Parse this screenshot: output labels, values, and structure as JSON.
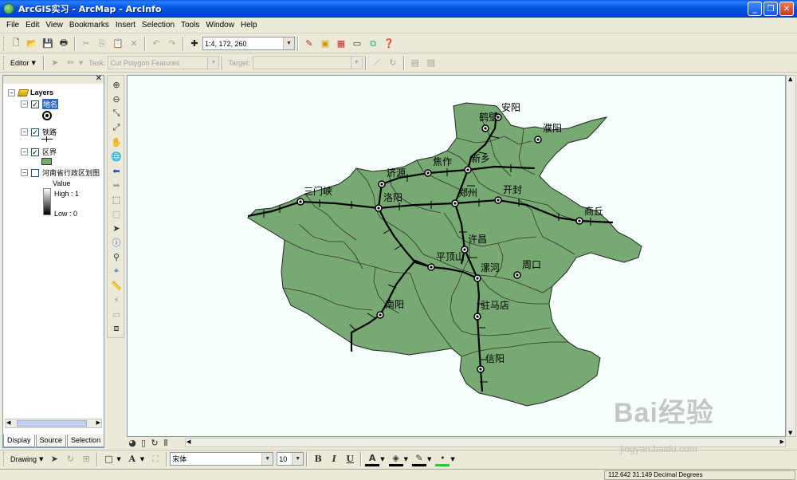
{
  "window": {
    "title": "ArcGIS实习 - ArcMap - ArcInfo"
  },
  "menu": [
    "File",
    "Edit",
    "View",
    "Bookmarks",
    "Insert",
    "Selection",
    "Tools",
    "Window",
    "Help"
  ],
  "standard_toolbar": {
    "scale": "1:4, 172, 260"
  },
  "editor_toolbar": {
    "editor_label": "Editor",
    "task_label": "Task:",
    "task_value": "Cut Polygon Features",
    "target_label": "Target:",
    "target_value": ""
  },
  "toc": {
    "root": "Layers",
    "layers": [
      {
        "name": "地名",
        "checked": true,
        "selected": true
      },
      {
        "name": "铁路",
        "checked": true
      },
      {
        "name": "区界",
        "checked": true
      },
      {
        "name": "河南省行政区划图",
        "checked": false
      }
    ],
    "raster_legend": {
      "value_label": "Value",
      "high_label": "High : 1",
      "low_label": "Low : 0"
    },
    "tabs": [
      "Display",
      "Source",
      "Selection"
    ]
  },
  "map": {
    "fill_color": "#76aa72",
    "background": "#f6fffe",
    "cities": [
      {
        "name": "安阳"
      },
      {
        "name": "鹤壁"
      },
      {
        "name": "濮阳"
      },
      {
        "name": "新乡"
      },
      {
        "name": "焦作"
      },
      {
        "name": "济源"
      },
      {
        "name": "三门峡"
      },
      {
        "name": "洛阳"
      },
      {
        "name": "郑州"
      },
      {
        "name": "开封"
      },
      {
        "name": "商丘"
      },
      {
        "name": "许昌"
      },
      {
        "name": "平顶山"
      },
      {
        "name": "漯河"
      },
      {
        "name": "周口"
      },
      {
        "name": "南阳"
      },
      {
        "name": "驻马店"
      },
      {
        "name": "信阳"
      }
    ]
  },
  "drawing_toolbar": {
    "drawing_label": "Drawing",
    "font_name": "宋体",
    "font_size": "10"
  },
  "status": {
    "coordinates": "112.642  31.149 Decimal Degrees"
  },
  "watermark": {
    "logo": "Bai经验",
    "url": "jingyan.baidu.com"
  }
}
